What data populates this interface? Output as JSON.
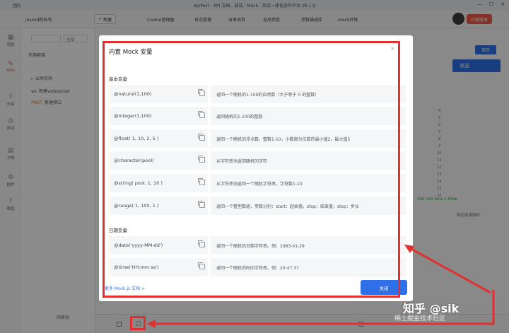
{
  "titlebar": {
    "brand": "团队",
    "title": "ApiPost - API 文档、调试、Mock、测试一体化协作平台 V6.1.0",
    "min": "—",
    "max": "☐",
    "close": "✕"
  },
  "toolbar": {
    "team": "Jasxxd的私有",
    "new_label": "新建",
    "items": [
      "Cookie管理器",
      "日志管理",
      "分享项目",
      "全局参数",
      "参数描述库",
      "mock环境"
    ],
    "upgrade_label": "升级版本"
  },
  "rail": {
    "items": [
      {
        "label": "项目",
        "icon": "grid-icon"
      },
      {
        "label": "APIs",
        "icon": "api-icon"
      },
      {
        "label": "分享",
        "icon": "share-icon"
      },
      {
        "label": "测试",
        "icon": "test-icon"
      },
      {
        "label": "文档",
        "icon": "doc-icon"
      },
      {
        "label": "插件",
        "icon": "plugin-icon"
      },
      {
        "label": "帮助",
        "icon": "help-icon"
      }
    ]
  },
  "sidebar": {
    "filter": "全部",
    "section": "示例项目",
    "items": [
      {
        "method": "",
        "label": "公共示例"
      },
      {
        "method": "ws",
        "label": "新建websocket"
      },
      {
        "method": "POST",
        "label": "新建接口"
      }
    ],
    "bottom": "回收站"
  },
  "main": {
    "save_label": "保存",
    "send_label": "发送",
    "code_lines": [
      "4",
      "5",
      "6",
      "7",
      "8",
      "9",
      "10",
      "11",
      "12",
      "13",
      "14",
      "15",
      "16"
    ],
    "status": "200  120.0ms  1.93kb",
    "status2": "响应结果解析"
  },
  "modal": {
    "title": "内置 Mock 变量",
    "close": "×",
    "section_basic": "基本变量",
    "section_date": "日期变量",
    "basic": [
      {
        "name": "@natural(1,100)",
        "desc": "返回一个随机的1-100的自然数（大于等于 0 的整数）"
      },
      {
        "name": "@integer(1,100)",
        "desc": "返回随机的1-100的整数"
      },
      {
        "name": "@float( 1, 10, 2, 5 )",
        "desc": "返回一个随机的浮点数，整数1-10，小数部分位数的最小值2，最大值5"
      },
      {
        "name": "@character(pool)",
        "desc": "从字符串池返回随机的字符"
      },
      {
        "name": "@string( pool, 1, 10 )",
        "desc": "从字符串池返回一个随机字符串，字符数1-10"
      },
      {
        "name": "@range( 1, 100, 1 )",
        "desc": "返回一个整型数组，参数分别：start：起始值，stop：结束值，step：步长"
      }
    ],
    "date": [
      {
        "name": "@date('yyyy-MM-dd')",
        "desc": "返回一个随机的日期字符串。例：1983-01-29"
      },
      {
        "name": "@time('HH:mm:ss')",
        "desc": "返回一个随机的时间字符串。例：20:47:37"
      }
    ],
    "more_link": "更多 Mock.js 文档  >",
    "close_button": "关闭"
  },
  "watermark": {
    "main": "知乎 @sik",
    "sub": "稀土掘金技术社区"
  },
  "colors": {
    "accent": "#2f6fe8",
    "annotation": "#e03030",
    "upgrade": "#f15a47"
  }
}
